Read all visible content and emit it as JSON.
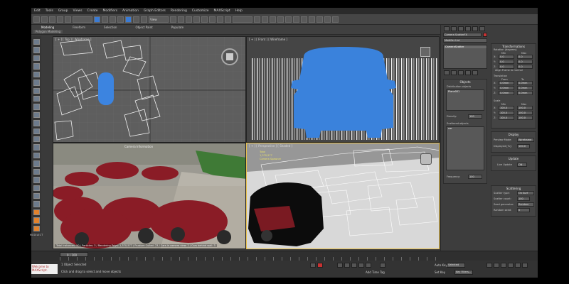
{
  "menubar": [
    "Edit",
    "Tools",
    "Group",
    "Views",
    "Create",
    "Modifiers",
    "Animation",
    "Graph Editors",
    "Rendering",
    "Customize",
    "MAXScript",
    "Help"
  ],
  "toolbar": {
    "selection_set": "",
    "view_dropdown": "View"
  },
  "ribbon": {
    "tabs": [
      "Modeling",
      "Freeform",
      "Selection",
      "Object Paint",
      "Populate"
    ],
    "active_tab": "Modeling",
    "sub_label": "Polygon Modeling"
  },
  "left_tools": {
    "label": "MCSELECT"
  },
  "viewports": {
    "top": "[ + ] [ Top ] [ Wireframe ]",
    "front": "[ + ] [ Front ] [ Wireframe ]",
    "render_caption": "Camera Information",
    "render_stats": "Total Instances: 50 / Particles: 3 / Rendering Polys: 1,370,577 / Frustum Culled: 23 / Cars in camera view: 2 / Cars behind wall: 3",
    "perspective": "[ + ] [ Perspective ] [ Shaded ]",
    "hud": [
      "Total",
      "1,370,577",
      "Camera Spawner"
    ]
  },
  "command_panel": {
    "name_field": "Camera ScatterFX",
    "modifier_list": "Modifier List",
    "stack_item": "CameraScatter",
    "transformations": {
      "title": "Transformations",
      "rotation_label": "Rotation (degrees)",
      "rot_min_label": "Min",
      "rot_max_label": "Max",
      "rot_min": [
        "0.0",
        "0.0",
        "0.0"
      ],
      "rot_max": [
        "0.0",
        "0.0",
        "0.0"
      ],
      "align_label": "Align Frame to normal",
      "translation_label": "Translation",
      "trans_min_label": "From",
      "trans_max_label": "To",
      "trans_min": [
        "0.0mm",
        "0.0mm",
        "0.0mm"
      ],
      "trans_max": [
        "0.0mm",
        "0.0mm",
        "0.0mm"
      ],
      "scale_label": "Scale",
      "scale_min_label": "Min",
      "scale_max_label": "Max",
      "scale_min": [
        "100.0",
        "100.0",
        "100.0"
      ],
      "scale_max": [
        "100.0",
        "100.0",
        "100.0"
      ],
      "axis_labels": [
        "X:",
        "Y:",
        "Z:"
      ]
    },
    "objects": {
      "title": "Objects",
      "distribution_label": "Distribution objects",
      "distribution_item": "Plane001",
      "density_label": "Density:",
      "density_value": "100",
      "scattered_label": "Scattered objects",
      "scattered_item": "car",
      "frequency_label": "Frequency:",
      "frequency_value": "100"
    },
    "display": {
      "title": "Display",
      "preview_label": "Preview Mode:",
      "preview_value": "Wireframe",
      "displayed_label": "Displayed [%]:",
      "displayed_value": "100.0"
    },
    "update": {
      "title": "Update",
      "live_label": "Live Update",
      "live_value": "ON"
    },
    "scattering": {
      "title": "Scattering",
      "type_label": "Scatter type:",
      "type_value": "On Surf",
      "count_label": "Scatter count:",
      "count_value": "100",
      "seed_label": "Seed generator:",
      "seed_value": "Random",
      "random_label": "Random seed:",
      "random_value": "0"
    }
  },
  "timeline": {
    "frame_label": "0 / 100"
  },
  "status": {
    "maxscript": "Welcome to MAXScript.",
    "selected": "1 Object Selected",
    "prompt": "Click and drag to select and move objects",
    "add_time_tag": "Add Time Tag",
    "auto_key": "Auto Key",
    "selected_dropdown": "Selected",
    "set_key": "Set Key",
    "key_filters": "Key Filters..."
  }
}
